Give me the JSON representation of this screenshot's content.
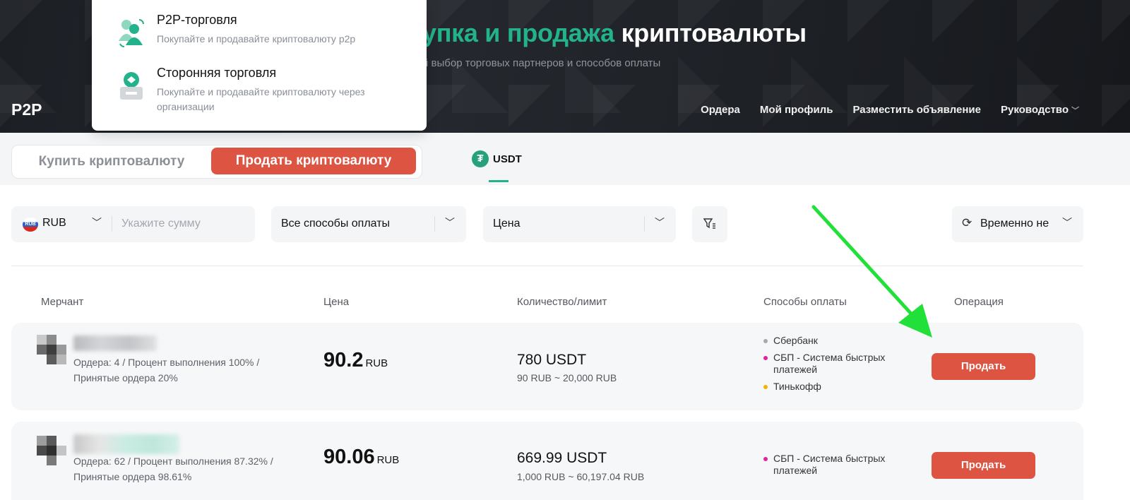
{
  "hero": {
    "title_highlight": "упка и продажа",
    "title_rest": "криптовалюты",
    "subtitle": "й выбор торговых партнеров и способов оплаты",
    "brand": "P2P",
    "nav": [
      "Ордера",
      "Мой профиль",
      "Разместить объявление",
      "Руководство"
    ]
  },
  "dropdown": {
    "items": [
      {
        "title": "P2P-торговля",
        "desc": "Покупайте и продавайте криптовалюту p2p",
        "icon": "p2p-users-icon"
      },
      {
        "title": "Сторонняя торговля",
        "desc": "Покупайте и продавайте криптовалюту через организации",
        "icon": "third-party-box-icon"
      }
    ]
  },
  "trade_toggle": {
    "buy": "Купить криптовалюту",
    "sell": "Продать криптовалюту",
    "active": "sell"
  },
  "coin_tab": {
    "label": "USDT",
    "icon": "tether-icon",
    "color": "#26a17b"
  },
  "filters": {
    "currency": "RUB",
    "currency_flag_text": "RUB",
    "amount_placeholder": "Укажите сумму",
    "payment_method": "Все способы оплаты",
    "sort": "Цена",
    "refresh": "Временно не"
  },
  "table": {
    "headers": {
      "merchant": "Мерчант",
      "price": "Цена",
      "qty": "Количество/лимит",
      "payment": "Способы оплаты",
      "operation": "Операция"
    },
    "rows": [
      {
        "stats": "Ордера: 4 / Процент выполнения 100% / Принятые ордера 20%",
        "price": "90.2",
        "price_unit": "RUB",
        "qty": "780 USDT",
        "limit": "90 RUB ~ 20,000 RUB",
        "payments": [
          {
            "name": "Сбербанк",
            "color": "#a6a9ad"
          },
          {
            "name": "СБП - Система быстрых платежей",
            "color": "#e0259b"
          },
          {
            "name": "Тинькофф",
            "color": "#f5b400"
          }
        ],
        "action": "Продать"
      },
      {
        "stats": "Ордера: 62 / Процент выполнения 87.32% / Принятые ордера 98.61%",
        "price": "90.06",
        "price_unit": "RUB",
        "qty": "669.99 USDT",
        "limit": "1,000 RUB ~ 60,197.04 RUB",
        "payments": [
          {
            "name": "СБП - Система быстрых платежей",
            "color": "#e0259b"
          }
        ],
        "action": "Продать"
      }
    ]
  },
  "colors": {
    "accent_green": "#22b28c",
    "sell_red": "#de5442",
    "annotation_arrow": "#22e03a"
  }
}
